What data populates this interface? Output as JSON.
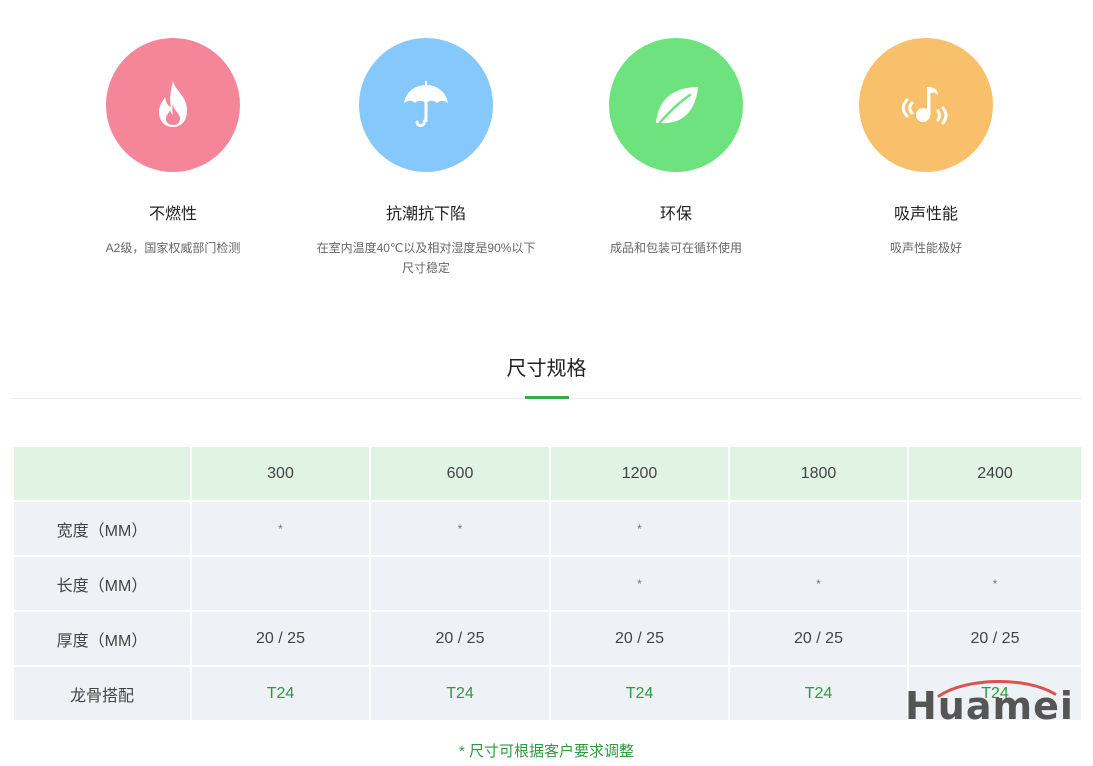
{
  "features": [
    {
      "title": "不燃性",
      "desc_lines": [
        "A2级，国家权威部门检测"
      ],
      "color": "#f5869a",
      "icon": "flame-icon"
    },
    {
      "title": "抗潮抗下陷",
      "desc_lines": [
        "在室内温度40℃以及相对湿度是90%以下",
        "尺寸稳定"
      ],
      "color": "#85c8fb",
      "icon": "umbrella-icon"
    },
    {
      "title": "环保",
      "desc_lines": [
        "成品和包装可在循环使用"
      ],
      "color": "#6ee27e",
      "icon": "leaf-icon"
    },
    {
      "title": "吸声性能",
      "desc_lines": [
        "吸声性能极好"
      ],
      "color": "#f8c06a",
      "icon": "music-note-icon"
    }
  ],
  "section": {
    "title": "尺寸规格",
    "accent": "#3aa94a"
  },
  "table": {
    "headers": [
      "",
      "300",
      "600",
      "1200",
      "1800",
      "2400"
    ],
    "rows": [
      {
        "label": "宽度（MM）",
        "cells": [
          "*",
          "*",
          "*",
          "",
          ""
        ]
      },
      {
        "label": "长度（MM）",
        "cells": [
          "",
          "",
          "*",
          "*",
          "*"
        ]
      },
      {
        "label": "厚度（MM）",
        "cells": [
          "20 / 25",
          "20 / 25",
          "20 / 25",
          "20 / 25",
          "20 / 25"
        ]
      },
      {
        "label": "龙骨搭配",
        "cells": [
          "T24",
          "T24",
          "T24",
          "T24",
          "T24"
        ]
      }
    ]
  },
  "note": "*  尺寸可根据客户要求调整",
  "watermark": {
    "text": "Huamei",
    "arc_color": "#d9534f"
  }
}
